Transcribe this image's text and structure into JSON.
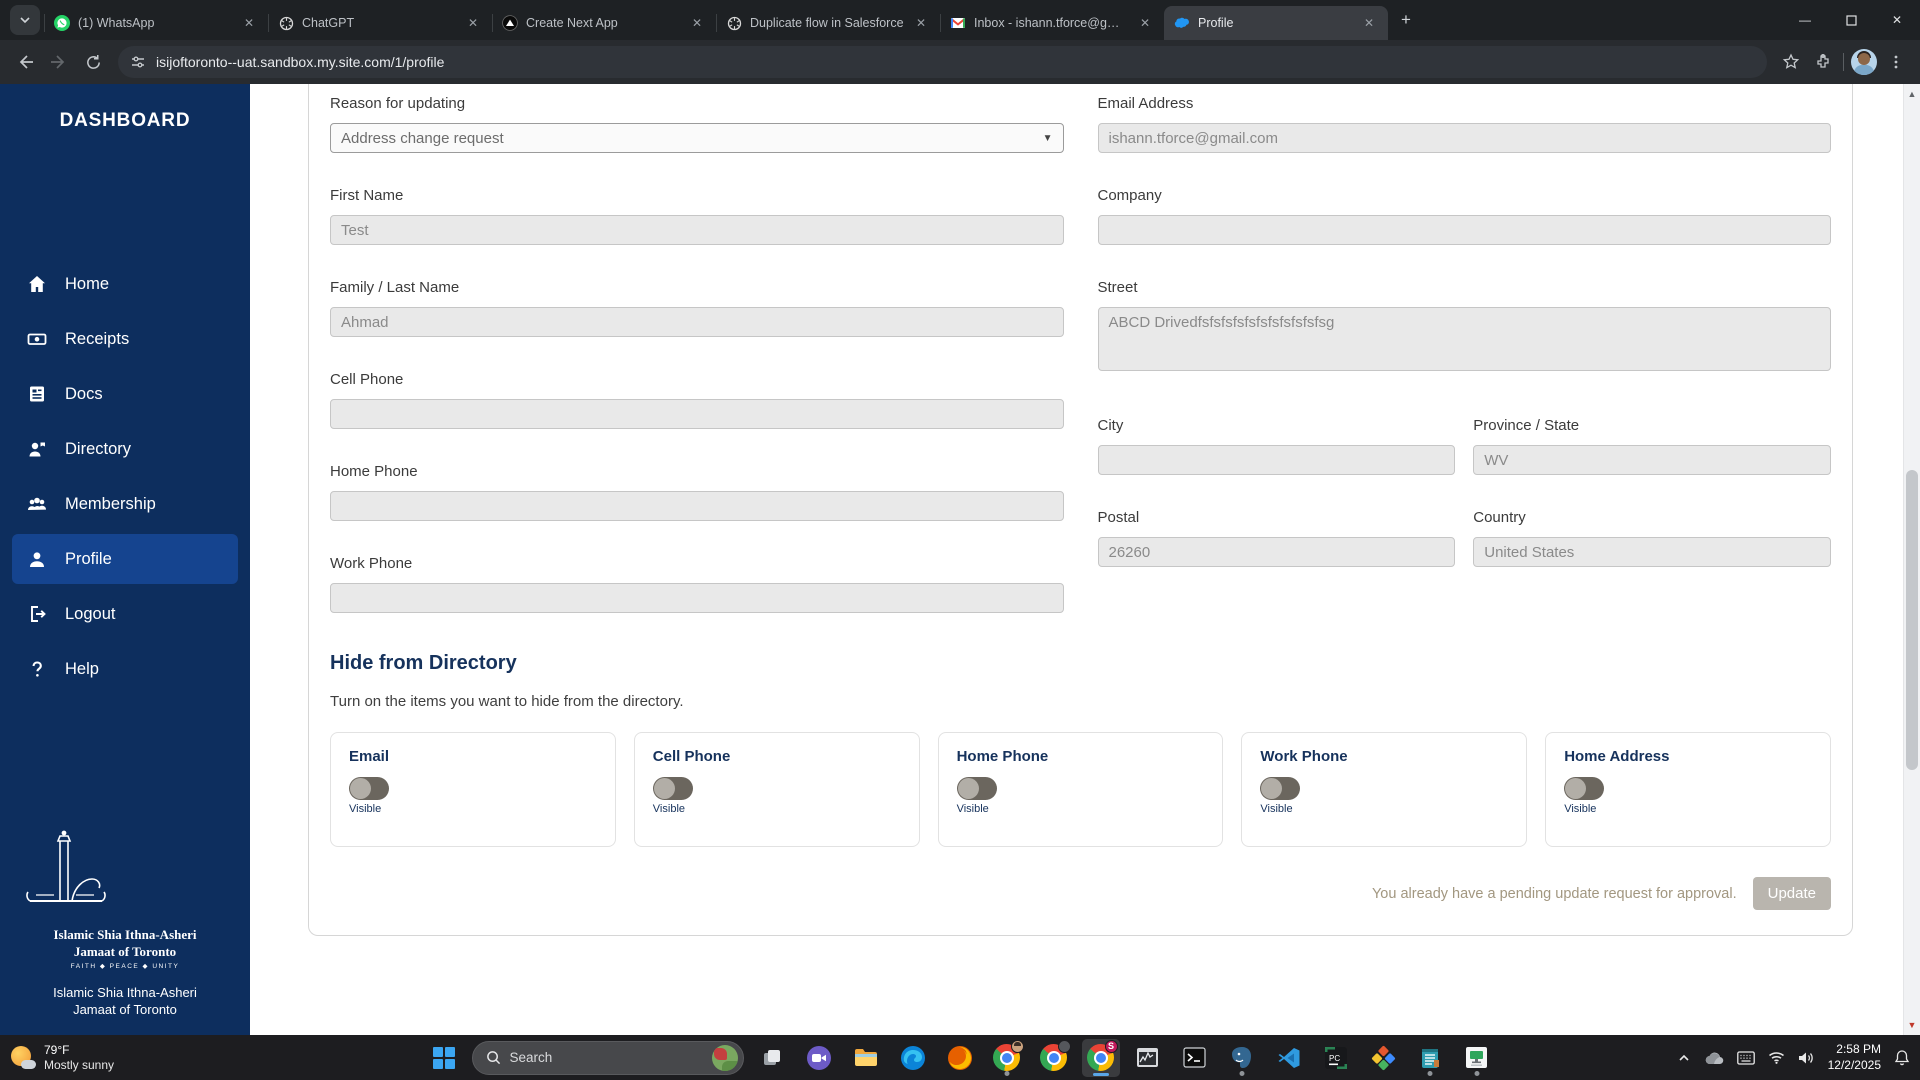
{
  "browser": {
    "tabs": [
      {
        "icon": "whatsapp-icon",
        "label": "(1) WhatsApp"
      },
      {
        "icon": "chatgpt-icon",
        "label": "ChatGPT"
      },
      {
        "icon": "vercel-icon",
        "label": "Create Next App"
      },
      {
        "icon": "chatgpt-icon",
        "label": "Duplicate flow in Salesforce"
      },
      {
        "icon": "gmail-icon",
        "label": "Inbox - ishann.tforce@gmail.co"
      },
      {
        "icon": "salesforce-cloud-icon",
        "label": "Profile"
      }
    ],
    "url": "isijoftoronto--uat.sandbox.my.site.com/1/profile"
  },
  "sidebar": {
    "title": "DASHBOARD",
    "items": [
      {
        "label": "Home",
        "icon": "home-icon"
      },
      {
        "label": "Receipts",
        "icon": "receipts-icon"
      },
      {
        "label": "Docs",
        "icon": "docs-icon"
      },
      {
        "label": "Directory",
        "icon": "directory-icon"
      },
      {
        "label": "Membership",
        "icon": "membership-icon"
      },
      {
        "label": "Profile",
        "icon": "profile-icon"
      },
      {
        "label": "Logout",
        "icon": "logout-icon"
      },
      {
        "label": "Help",
        "icon": "help-icon"
      }
    ],
    "logo": {
      "line1": "Islamic Shia Ithna-Asheri",
      "line2": "Jamaat of Toronto",
      "motto": "FAITH ◆ PEACE ◆ UNITY"
    },
    "org_name": "Islamic Shia Ithna-Asheri Jamaat of Toronto"
  },
  "form": {
    "reason": {
      "label": "Reason for updating",
      "value": "Address change request"
    },
    "first_name": {
      "label": "First Name",
      "value": "Test"
    },
    "last_name": {
      "label": "Family / Last Name",
      "value": "Ahmad"
    },
    "cell_phone": {
      "label": "Cell Phone",
      "value": ""
    },
    "home_phone": {
      "label": "Home Phone",
      "value": ""
    },
    "work_phone": {
      "label": "Work Phone",
      "value": ""
    },
    "email": {
      "label": "Email Address",
      "value": "ishann.tforce@gmail.com"
    },
    "company": {
      "label": "Company",
      "value": ""
    },
    "street": {
      "label": "Street",
      "value": "ABCD Drivedfsfsfsfsfsfsfsfsfsfsfsg"
    },
    "city": {
      "label": "City",
      "value": ""
    },
    "province": {
      "label": "Province / State",
      "value": "WV"
    },
    "postal": {
      "label": "Postal",
      "value": "26260"
    },
    "country": {
      "label": "Country",
      "value": "United States"
    }
  },
  "hide_directory": {
    "title": "Hide from Directory",
    "subtitle": "Turn on the items you want to hide from the directory.",
    "toggles": [
      {
        "label": "Email",
        "state": "Visible"
      },
      {
        "label": "Cell Phone",
        "state": "Visible"
      },
      {
        "label": "Home Phone",
        "state": "Visible"
      },
      {
        "label": "Work Phone",
        "state": "Visible"
      },
      {
        "label": "Home Address",
        "state": "Visible"
      }
    ]
  },
  "footer": {
    "message": "You already have a pending update request for approval.",
    "update_label": "Update"
  },
  "taskbar": {
    "weather": {
      "temp": "79°F",
      "condition": "Mostly sunny"
    },
    "search_placeholder": "Search",
    "app_icons": [
      "task-view-icon",
      "video-app-icon",
      "file-explorer-icon",
      "edge-icon",
      "firefox-icon",
      "chrome-profile-icon",
      "chrome-secondary-icon",
      "chrome-active-icon",
      "system-monitor-icon",
      "terminal-icon",
      "postgresql-icon",
      "vscode-icon",
      "pycharm-icon",
      "diamond-shapes-app-icon",
      "notes-app-icon",
      "monitor-tool-icon"
    ],
    "clock": {
      "time": "2:58 PM",
      "date": "12/2/2025"
    }
  },
  "colors": {
    "sidebar_bg": "#0d2e5e",
    "sidebar_active": "#15448f",
    "heading_navy": "#16325c",
    "pending_text": "#a29780",
    "disabled_button": "#b9b5ae",
    "input_bg": "#e9e9e9",
    "salesforce_blue": "#00a1e0"
  }
}
